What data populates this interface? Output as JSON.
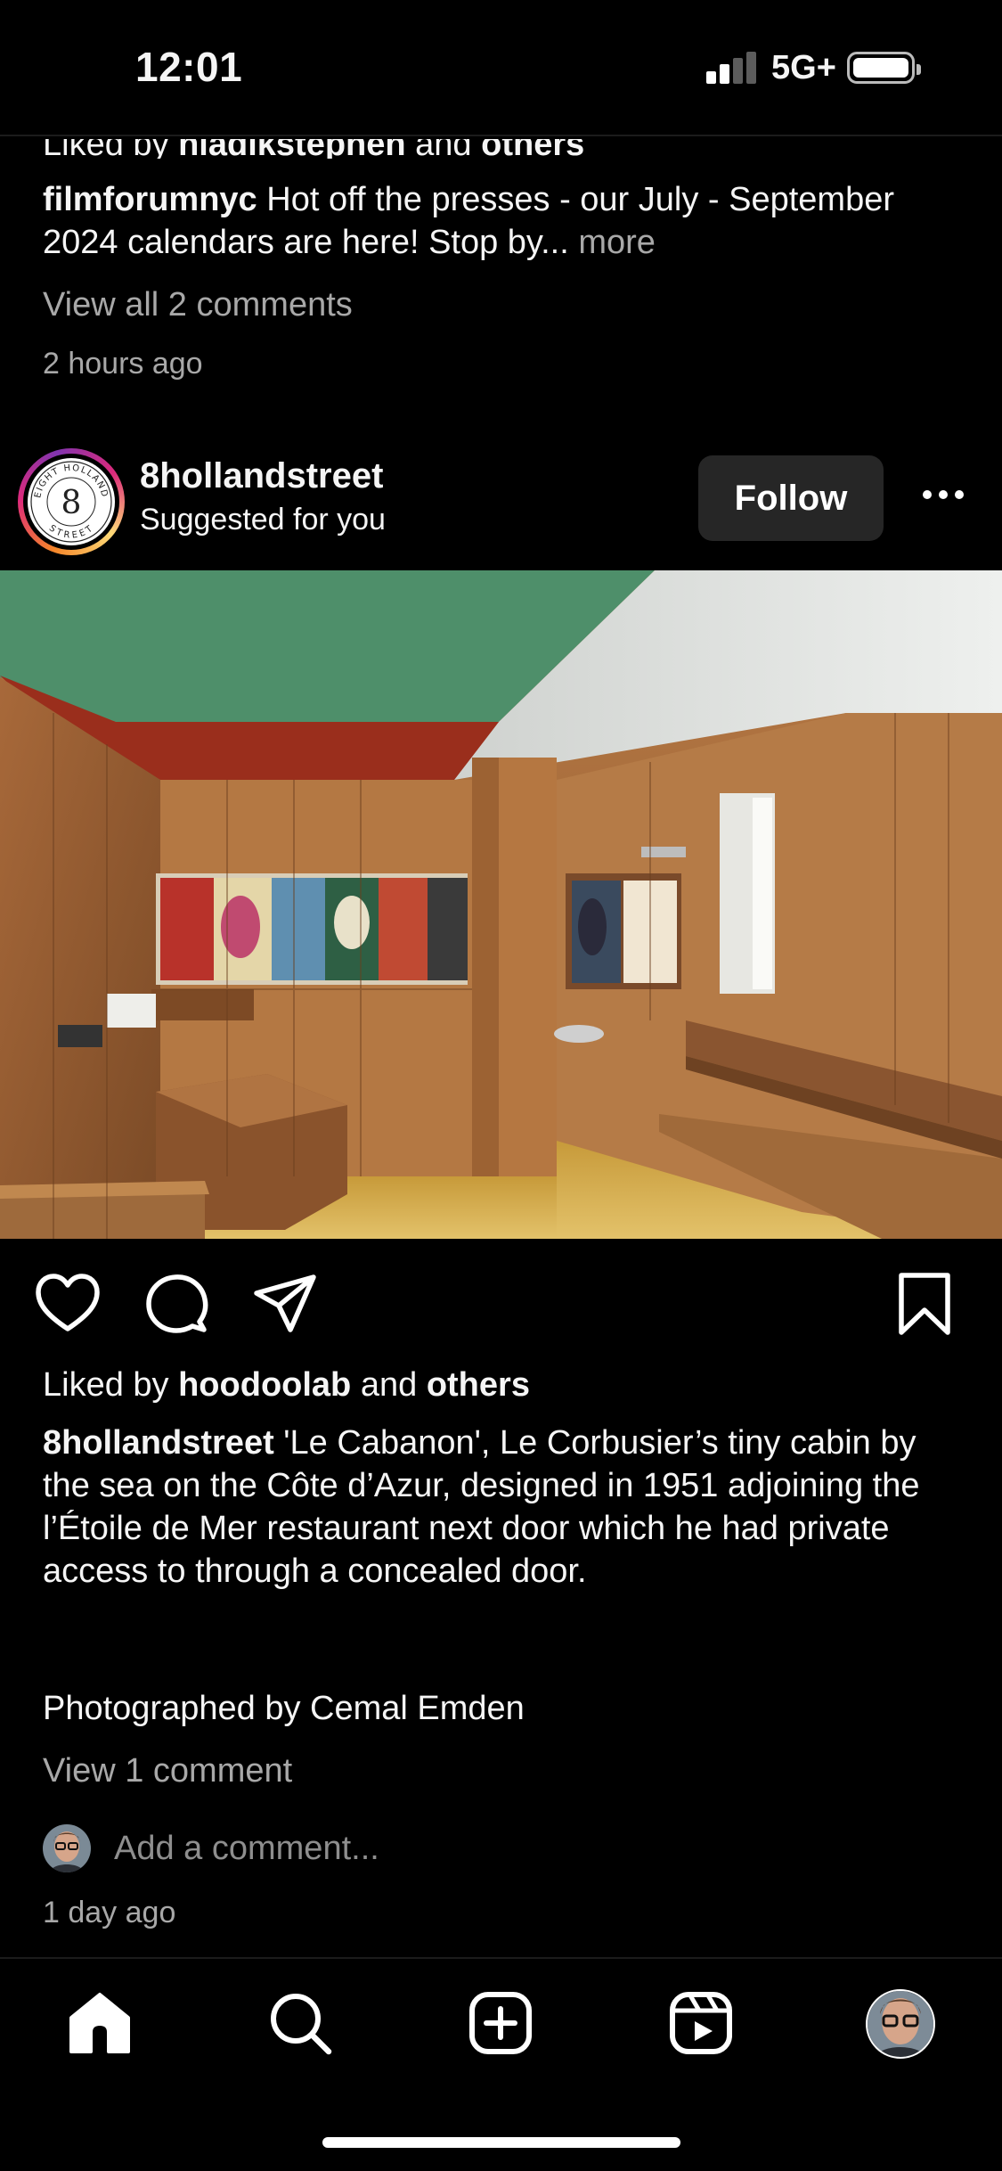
{
  "status_bar": {
    "time": "12:01",
    "network": "5G+"
  },
  "previous_post": {
    "liked_prefix": "Liked by ",
    "liked_user": "hladikstephen",
    "liked_mid": " and ",
    "liked_others": "others",
    "caption_user": "filmforumnyc",
    "caption_text": " Hot off the presses - our July - September 2024 calendars are here! Stop by...",
    "more_label": " more",
    "view_comments": "View all 2 comments",
    "timestamp": "2 hours ago"
  },
  "post": {
    "username": "8hollandstreet",
    "subtitle": "Suggested for you",
    "follow_label": "Follow",
    "avatar_text_top": "EIGHT HOLLAND",
    "avatar_text_bottom": "STREET",
    "avatar_numeral": "8",
    "liked_prefix": "Liked by ",
    "liked_user": "hoodoolab",
    "liked_mid": " and ",
    "liked_others": "others",
    "caption_user": "8hollandstreet",
    "caption_text": " 'Le Cabanon', Le Corbusier’s tiny cabin by the sea on the Côte d’Azur, designed in 1951 adjoining the l’Étoile de Mer restaurant next door which he had private access to through a concealed door.",
    "caption_credit": "Photographed by Cemal Emden",
    "view_comments": "View 1 comment",
    "add_comment_placeholder": "Add a comment...",
    "timestamp": "1 day ago"
  },
  "icons": {
    "like": "heart-icon",
    "comment": "comment-bubble-icon",
    "share": "paper-plane-icon",
    "save": "bookmark-icon",
    "more": "more-horizontal-icon",
    "tab_home": "home-icon",
    "tab_search": "search-icon",
    "tab_create": "add-square-icon",
    "tab_reels": "reels-icon",
    "tab_profile": "profile-avatar"
  },
  "colors": {
    "background": "#000000",
    "follow_button": "#262626",
    "muted_text": "#a8a8a8"
  }
}
